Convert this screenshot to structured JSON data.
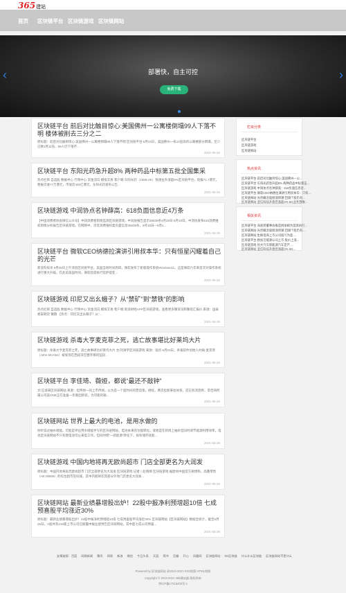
{
  "site": {
    "logo_number": "365",
    "logo_text": "建站"
  },
  "nav": {
    "items": [
      "首页",
      "区块链平台",
      "区块链游戏",
      "区块链网站"
    ]
  },
  "banner": {
    "title": "部署快，自主可控",
    "button": "免费下载"
  },
  "articles": [
    {
      "title": "区块链平台 前后对比触目惊心:美国佛州一公寓楼倒塌99人下落不明 楼体被削去三分之二",
      "excerpt": "原标题：前后对比触目惊心:美国佛州一公寓楼倒塌99人下落不明 区块链平台 6月24日，美国佛州一栋12层高的公寓楼部分倒塌，至少已致1死11伤、99人仍下落不...",
      "date": "2021-06-26"
    },
    {
      "title": "区块链平台 东阳光药急升超8% 两种药品中标第五批全国集采",
      "excerpt": "热点栏目 自选股 数据中心 行情中心 资金流向 模拟交易 客户端 东阳光药（1558.HK）快速拉升涨超8%区块链平台，现报71.7港元，暂报交收77万港元，市值近400亿港元。东阳光药发布公告...",
      "date": "2021-06-26"
    },
    {
      "title": "区块链游戏 中润协点名钟薛高：618负面信息近4万条",
      "excerpt": "【中国消费者协会微信公众号】中润消费者舆情监测区块链游戏，中润协报告显示35639条4月25日-6月18日，中消协发布618消费维权舆情分析报告区块链游戏。在网络中，涉及消费维权类负面信息35639条，6月15日—6月1...",
      "date": "2021-06-26"
    },
    {
      "title": "区块链平台 微软CEO纳德拉演讲引用叔本华：只有恒星闪耀着自己的光芒",
      "excerpt": "新浪科技讯 6月25日上午消息区块链平台，美国当地时间周四，微软发布了新版操作系统Windows11。这是微软六年来首次对操作系统进行重大升级。在此前美国时间，微软首席执行官萨提亚...",
      "date": "2021-06-26"
    },
    {
      "title": "区块链游戏 印尼又出幺蛾子？从“禁矿”到“禁铁”的影响",
      "excerpt": "热点栏目 自选股 数据中心 行情中心 资金流向 模拟交易 客户端 新浪财经APP区块链游戏，查看更多镍资讯和镍现汇报价 来源：国泰君安期货 镍期 【热点：印尼又出幺蛾子？从“...",
      "date": "2021-06-26"
    },
    {
      "title": "区块链游戏 杀毒大亨麦克菲之死，逃亡故事堪比好莱坞大片",
      "excerpt": "原标题：杀毒大亨麦克菲之死，逃亡故事堪比好莱坞大片 文/刘清宇区块链游戏 来源：观点 6月23日，杀毒软件创始人约翰·麦克菲（John McAfee）被发现在西班牙巴塞罗那的监狱...",
      "date": "2021-06-26"
    },
    {
      "title": "区块链平台 李佳琦、薇娅，都说“最还不敲钟”",
      "excerpt": "文/王潇来区块链网站 来源：坦伟财一同上市传闻，以为是一个超时间的营造策，继续，两次拉新来往体系。还已有消息称，李佳琦所属公司美ONE正在准备一年集团新装，为可能的融...",
      "date": "2021-06-26"
    },
    {
      "title": "区块链网站 世界上最大的电池，是用水做的",
      "excerpt": "你听说过抽水储能。可能是单位用水储能手写的区块链网站，电池本来的功能转化，或者是在新周上抽水但同时调节能源利用效率，电池区块链网站不只有锂电池可以来电工作，但同时把“一新能源”转化下，如有储存就能...",
      "date": "2021-06-26"
    },
    {
      "title": "区块链游戏 中国内地将再无欧尚超市 门店全部更名为大润发",
      "excerpt": "原标题：中国内地将再无欧尚超市 门店全部更名为大润发 区块链游戏 记者丨赵晓晴 区块链游戏 据欧尚中国官方微博称，高鑫零售（HK:06808）的综合超市及同城，其中内部将在其部分外地门店更名大润发...",
      "date": "2021-06-26"
    },
    {
      "title": "区块链网站 最新业绩暴增股出炉！22股中报净利预增超10倍 七成预喜股平均涨近30%",
      "excerpt": "原标题：最新业绩暴增股出炉！22股中报净利预增超10倍 七成预喜股平均涨近30% 区块链网站【区块链网站】数据宝统计，截至6月25日，A股共有218家上市公司已披露中报业绩预告区块链网站，其中超七成公司预喜...",
      "date": "2021-06-26"
    }
  ],
  "sidebar": {
    "columns": {
      "title": "栏目分类",
      "links": [
        "区块链平台",
        "区块链游戏",
        "区块链网站"
      ]
    },
    "hot": {
      "title": "热点资讯",
      "links": [
        "区块链平台 前后对比触目惊心:美国佛州一公...",
        "区块链平台 东阳光药急升超8% 两种药品中标第五...",
        "区块链游戏 中润协点名钟薛高：618负面信息近...",
        "区块链平台 微软CEO纳德拉演讲引用叔本华：只有...",
        "区块链网站 光伏概念股掀涨停潮 回调个股仍有...",
        "区块链网站 亚信科技开盘后涨超4% 5G业务营收..."
      ]
    },
    "related": {
      "title": "相关资讯",
      "links": [
        "区块链平台 海底捞董事会推选杨丽娟为首席执行...",
        "区块链网站 光伏概念股掀涨停潮 回调个股仍有...",
        "区块链网站 生鲜电商上市公司扭亏为盈 ...",
        "区块链平台 欧加洁能源公司上市 股价上涨...",
        "区块链游戏 恒大汽车新能源汽车定产 ...",
        "区块链网站 亚信科技开盘后涨超4% 5G..."
      ]
    }
  },
  "footer": {
    "links": [
      "友情链接：百度",
      "网易新闻",
      "腾讯",
      "网易",
      "新浪",
      "微信",
      "今日头条",
      "天涯",
      "简书",
      "豆瓣",
      "开心",
      "凤凰网",
      "区块链网站",
      "5G区块链",
      "什么什么区块链",
      "区块链网站不是什么"
    ],
    "powered": "Powered by 区块链网站 @2013-2021 RSS地图 HTML地图",
    "copyright": "Copyright © 2013-2021 365建站器 版权所有",
    "icp": "京ICP备17015400号-1"
  }
}
